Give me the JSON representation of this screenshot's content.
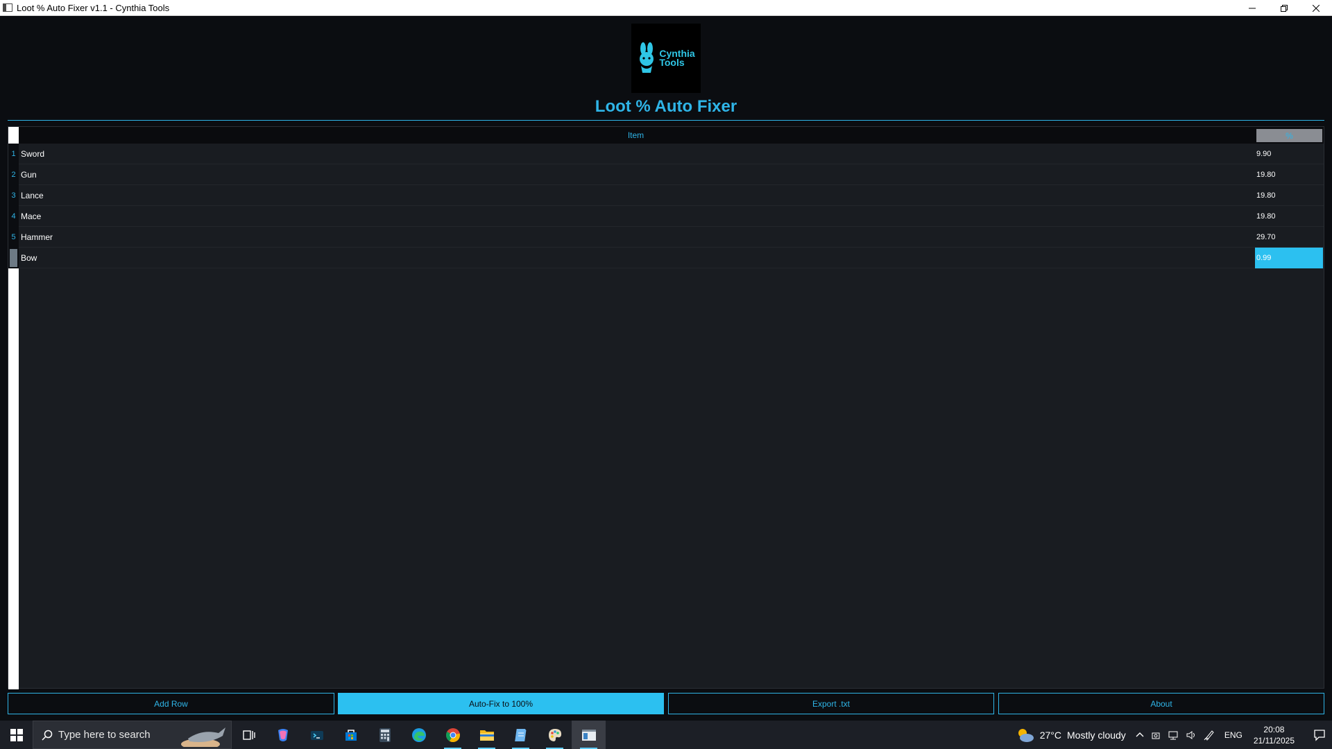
{
  "window": {
    "title": "Loot % Auto Fixer v1.1 - Cynthia Tools"
  },
  "logo": {
    "line1": "Cynthia",
    "line2": "Tools"
  },
  "app_title": "Loot % Auto Fixer",
  "table": {
    "headers": {
      "item": "Item",
      "pct": "%"
    },
    "rows": [
      {
        "num": "1",
        "item": "Sword",
        "pct": "9.90"
      },
      {
        "num": "2",
        "item": "Gun",
        "pct": "19.80"
      },
      {
        "num": "3",
        "item": "Lance",
        "pct": "19.80"
      },
      {
        "num": "4",
        "item": "Mace",
        "pct": "19.80"
      },
      {
        "num": "5",
        "item": "Hammer",
        "pct": "29.70"
      },
      {
        "num": "",
        "item": "Bow",
        "pct": "0.99"
      }
    ]
  },
  "buttons": {
    "add_row": "Add Row",
    "auto_fix": "Auto-Fix to 100%",
    "export": "Export .txt",
    "about": "About"
  },
  "taskbar": {
    "search_placeholder": "Type here to search",
    "weather_temp": "27°C",
    "weather_desc": "Mostly cloudy",
    "lang": "ENG",
    "time": "20:08",
    "date": "21/11/2025"
  },
  "colors": {
    "accent": "#2fb5e8",
    "selected_cell": "#2cc0f0",
    "background": "#0b0d11",
    "grid_bg": "#191c21"
  }
}
